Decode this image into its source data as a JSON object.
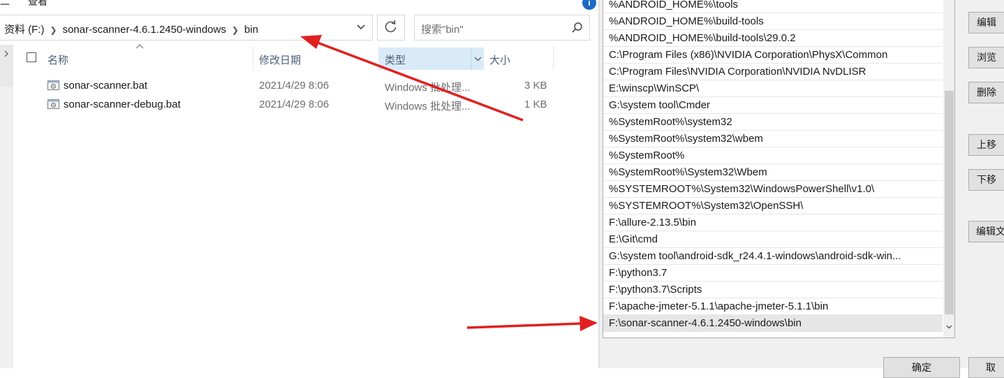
{
  "explorer": {
    "menu": {
      "left_cut": "二",
      "view_cut": "查看"
    },
    "help_icon": "help-icon",
    "breadcrumb": [
      "资料 (F:)",
      "sonar-scanner-4.6.1.2450-windows",
      "bin"
    ],
    "search": {
      "placeholder": "搜索\"bin\""
    },
    "columns": {
      "name": "名称",
      "date": "修改日期",
      "type": "类型",
      "size": "大小"
    },
    "files": [
      {
        "name": "sonar-scanner.bat",
        "date": "2021/4/29 8:06",
        "type": "Windows 批处理...",
        "size": "3 KB",
        "icon": "batch-file-icon"
      },
      {
        "name": "sonar-scanner-debug.bat",
        "date": "2021/4/29 8:06",
        "type": "Windows 批处理...",
        "size": "1 KB",
        "icon": "batch-file-icon"
      }
    ]
  },
  "env_dialog": {
    "paths": [
      "%ANDROID_HOME%\\tools",
      "%ANDROID_HOME%\\build-tools",
      "%ANDROID_HOME%\\build-tools\\29.0.2",
      "C:\\Program Files (x86)\\NVIDIA Corporation\\PhysX\\Common",
      "C:\\Program Files\\NVIDIA Corporation\\NVIDIA NvDLISR",
      "E:\\winscp\\WinSCP\\",
      "G:\\system tool\\Cmder",
      "%SystemRoot%\\system32",
      "%SystemRoot%\\system32\\wbem",
      "%SystemRoot%",
      "%SystemRoot%\\System32\\Wbem",
      "%SYSTEMROOT%\\System32\\WindowsPowerShell\\v1.0\\",
      "%SYSTEMROOT%\\System32\\OpenSSH\\",
      "F:\\allure-2.13.5\\bin",
      "E:\\Git\\cmd",
      "G:\\system tool\\android-sdk_r24.4.1-windows\\android-sdk-win...",
      "F:\\python3.7",
      "F:\\python3.7\\Scripts",
      "F:\\apache-jmeter-5.1.1\\apache-jmeter-5.1.1\\bin",
      "F:\\sonar-scanner-4.6.1.2450-windows\\bin"
    ],
    "selected_index": 19,
    "buttons": {
      "edit": "编辑",
      "browse": "浏览",
      "delete": "删除",
      "move_up": "上移",
      "move_down": "下移",
      "edit_text": "编辑文",
      "ok": "确定",
      "cancel": "取"
    }
  },
  "annotation_color": "#e02020"
}
